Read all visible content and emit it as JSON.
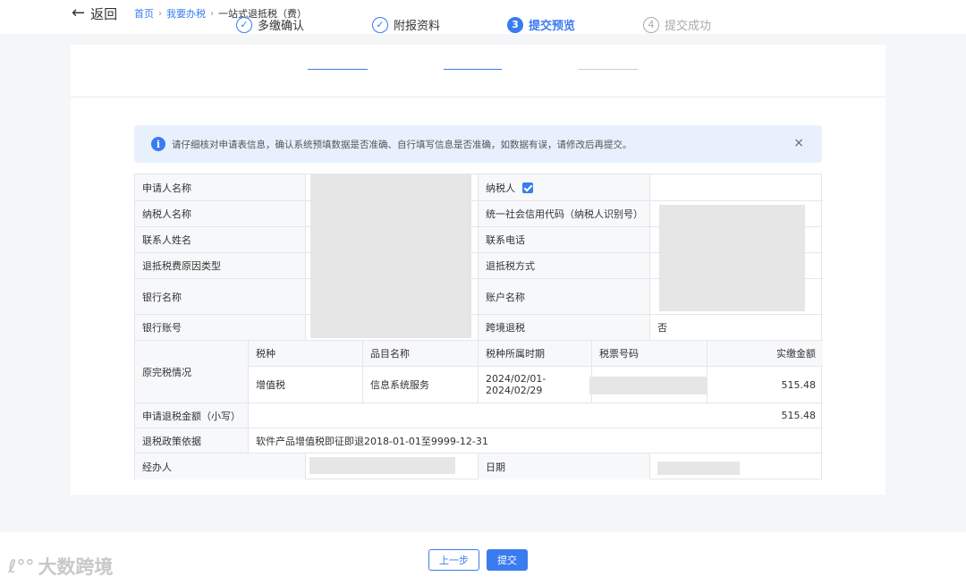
{
  "header": {
    "back_arrow": "←",
    "back_label": "返回",
    "breadcrumb": [
      {
        "label": "首页",
        "link": true
      },
      {
        "label": "我要办税",
        "link": true
      },
      {
        "label": "一站式退抵税（费）",
        "link": false
      }
    ],
    "separator": "›"
  },
  "steps": [
    {
      "index": "✓",
      "label": "多缴确认",
      "state": "done"
    },
    {
      "index": "✓",
      "label": "附报资料",
      "state": "done"
    },
    {
      "index": "3",
      "label": "提交预览",
      "state": "active"
    },
    {
      "index": "4",
      "label": "提交成功",
      "state": "todo"
    }
  ],
  "alert": {
    "icon": "i",
    "message": "请仔细核对申请表信息，确认系统预填数据是否准确、自行填写信息是否准确，如数据有误，请修改后再提交。",
    "close": "×"
  },
  "table": {
    "labels": {
      "applicant": "申请人名称",
      "taxpayer_name": "纳税人名称",
      "contact_name": "联系人姓名",
      "refund_reason": "退抵税费原因类型",
      "bank_name": "银行名称",
      "bank_account": "银行账号",
      "taxpayer_flag": "纳税人",
      "credit_code": "统一社会信用代码（纳税人识别号）",
      "contact_phone": "联系电话",
      "refund_method": "退抵税方式",
      "account_name": "账户名称",
      "cross_border": "跨境退税",
      "original_tax": "原完税情况",
      "refund_amount": "申请退税金额（小写）",
      "policy_basis": "退税政策依据",
      "handler": "经办人",
      "date": "日期"
    },
    "cross_border_value": "否",
    "sub_headers": [
      "税种",
      "品目名称",
      "税种所属时期",
      "税票号码",
      "实缴金额"
    ],
    "sub_row": {
      "tax_type": "增值税",
      "item_name": "信息系统服务",
      "period_start": "2024/02/01-",
      "period_end": "2024/02/29",
      "ticket_no": "",
      "paid_amount": "515.48"
    },
    "refund_amount_value": "515.48",
    "policy_value": "软件产品增值税即征即退2018-01-01至9999-12-31"
  },
  "buttons": {
    "prev": "上一步",
    "submit": "提交"
  },
  "watermark": {
    "logo": "ℓ°°",
    "text": "大数跨境"
  }
}
